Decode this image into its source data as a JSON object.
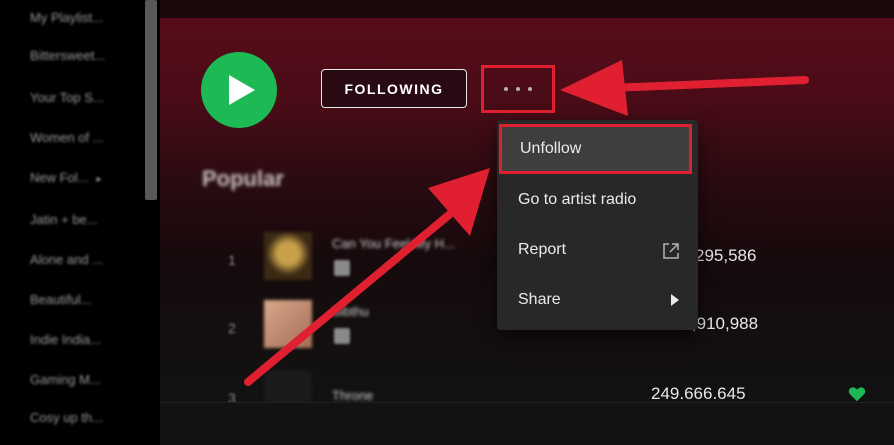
{
  "sidebar": {
    "items": [
      {
        "label": "My Playlist..."
      },
      {
        "label": "Bittersweet..."
      },
      {
        "label": "Your Top S..."
      },
      {
        "label": "Women of ..."
      },
      {
        "label": "New Fol...",
        "has_chevron": true
      },
      {
        "label": "Jatin + be..."
      },
      {
        "label": "Alone and ..."
      },
      {
        "label": "Beautiful..."
      },
      {
        "label": "Indie India..."
      },
      {
        "label": "Gaming M..."
      },
      {
        "label": "Cosy up th..."
      }
    ],
    "chevron": "▸"
  },
  "artist_actions": {
    "play_icon": "play-icon",
    "following_label": "FOLLOWING",
    "more_icon": "more-dots-icon"
  },
  "popular": {
    "title": "Popular",
    "tracks": [
      {
        "number": "1",
        "name": "Can You Feel My H...",
        "plays": "295,586"
      },
      {
        "number": "2",
        "name": "Sibthu",
        "plays": "20,910,988"
      },
      {
        "number": "3",
        "name": "Throne",
        "plays": "249.666.645",
        "liked": true
      }
    ]
  },
  "context_menu": {
    "items": [
      {
        "label": "Unfollow",
        "highlighted": true
      },
      {
        "label": "Go to artist radio"
      },
      {
        "label": "Report",
        "icon": "external-link-icon"
      },
      {
        "label": "Share",
        "icon": "chevron-right-icon"
      }
    ]
  },
  "colors": {
    "accent_green": "#1db954",
    "annotation_red": "#e02030",
    "menu_bg": "#282828",
    "header_gradient_top": "#5a0d1a"
  }
}
